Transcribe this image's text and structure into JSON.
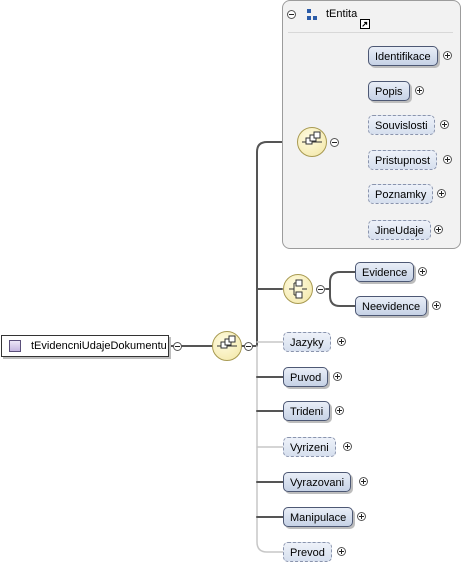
{
  "root": {
    "label": "tEvidencniUdajeDokumentu"
  },
  "type_group": {
    "label": "tEntita"
  },
  "entity_elements": [
    {
      "label": "Identifikace",
      "optional": false
    },
    {
      "label": "Popis",
      "optional": false
    },
    {
      "label": "Souvislosti",
      "optional": true
    },
    {
      "label": "Pristupnost",
      "optional": true
    },
    {
      "label": "Poznamky",
      "optional": true
    },
    {
      "label": "JineUdaje",
      "optional": true
    }
  ],
  "choice_elements": [
    {
      "label": "Evidence",
      "optional": false
    },
    {
      "label": "Neevidence",
      "optional": false
    }
  ],
  "main_elements": [
    {
      "label": "Jazyky",
      "optional": true
    },
    {
      "label": "Puvod",
      "optional": false
    },
    {
      "label": "Trideni",
      "optional": false
    },
    {
      "label": "Vyrizeni",
      "optional": true
    },
    {
      "label": "Vyrazovani",
      "optional": false
    },
    {
      "label": "Manipulace",
      "optional": false
    },
    {
      "label": "Prevod",
      "optional": true
    }
  ]
}
